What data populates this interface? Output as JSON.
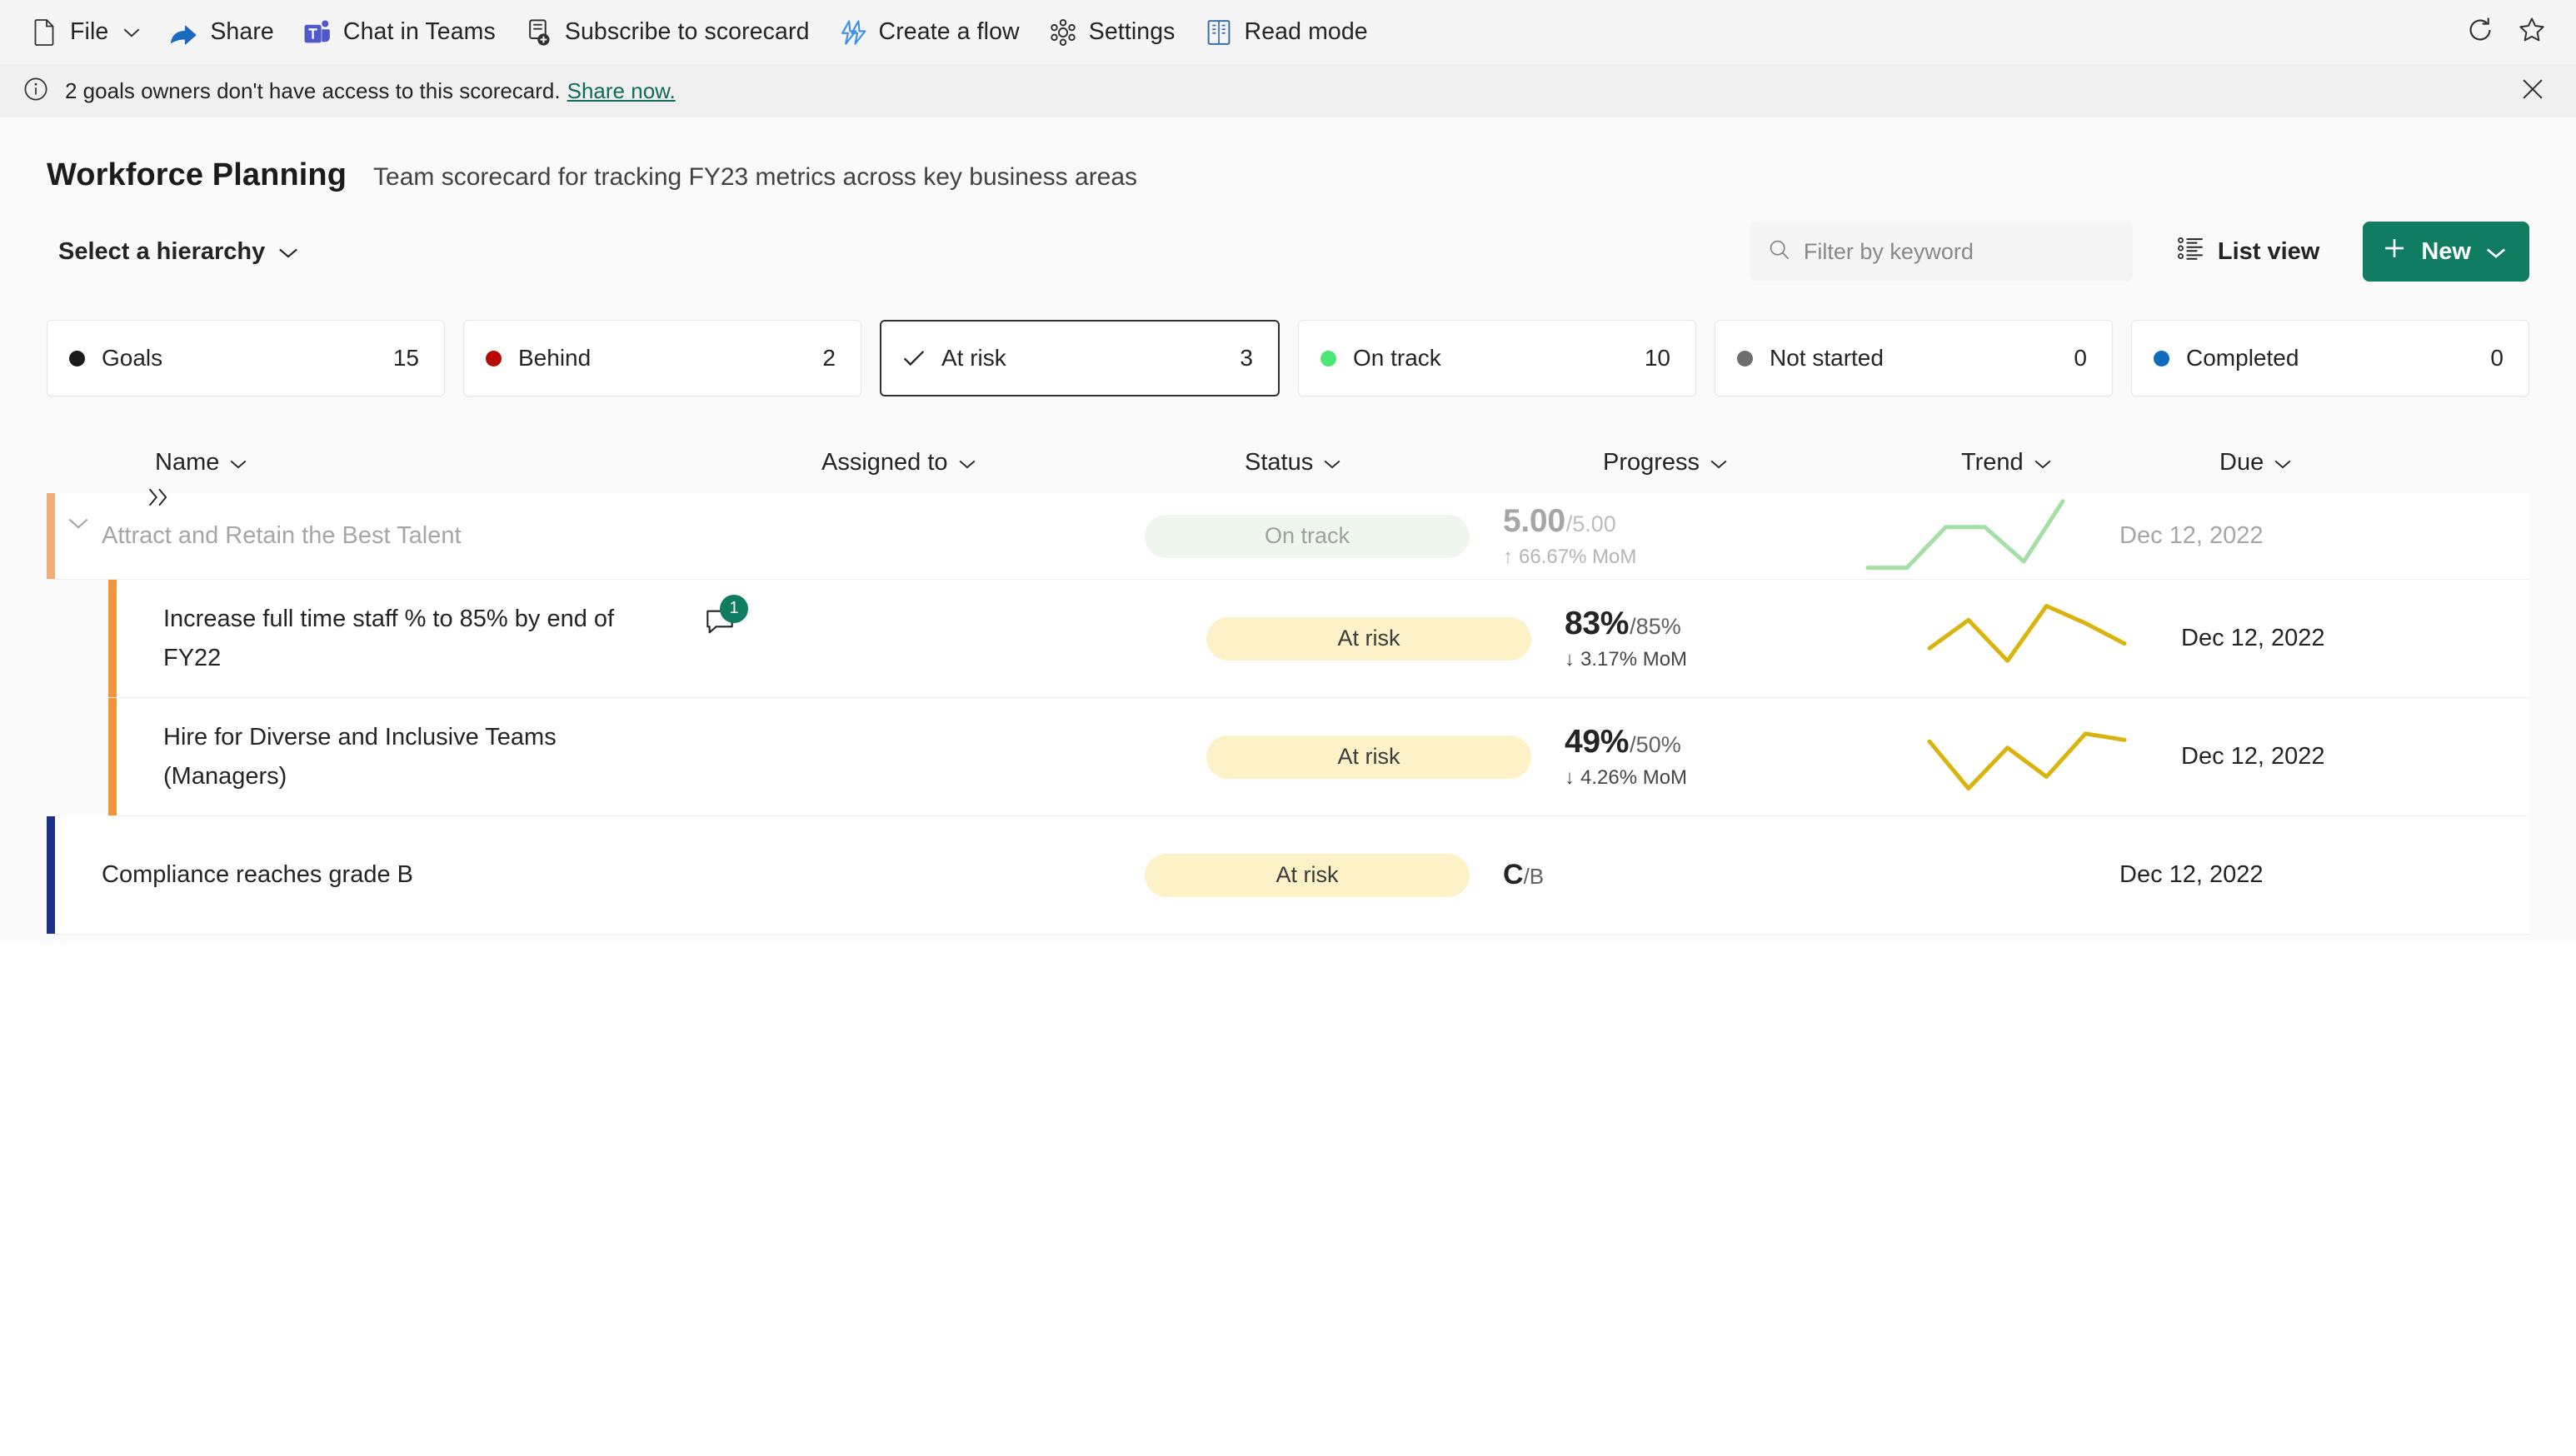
{
  "commandbar": {
    "items": [
      {
        "label": "File",
        "icon": "file-icon",
        "has_chevron": true
      },
      {
        "label": "Share",
        "icon": "share-icon",
        "has_chevron": false
      },
      {
        "label": "Chat in Teams",
        "icon": "teams-icon",
        "has_chevron": false
      },
      {
        "label": "Subscribe to scorecard",
        "icon": "subscribe-icon",
        "has_chevron": false
      },
      {
        "label": "Create a flow",
        "icon": "power-automate-icon",
        "has_chevron": false
      },
      {
        "label": "Settings",
        "icon": "gear-icon",
        "has_chevron": false
      },
      {
        "label": "Read mode",
        "icon": "read-mode-icon",
        "has_chevron": false
      }
    ],
    "right_icons": [
      {
        "name": "refresh-icon"
      },
      {
        "name": "favorite-star-icon"
      }
    ]
  },
  "messagebar": {
    "icon": "info-icon",
    "text": "2 goals owners don't have access to this scorecard.",
    "link": "Share now.",
    "close_icon": "close-icon"
  },
  "header": {
    "title": "Workforce Planning",
    "subtitle": "Team scorecard for tracking FY23 metrics across key business areas",
    "hierarchy_label": "Select a hierarchy"
  },
  "toolbar": {
    "search_placeholder": "Filter by keyword",
    "search_value": "",
    "list_view_label": "List view",
    "new_label": "New"
  },
  "pills": [
    {
      "label": "Goals",
      "count": "15",
      "color": "#1b1b1b",
      "selected": false,
      "marker": "dot"
    },
    {
      "label": "Behind",
      "count": "2",
      "color": "#b80b05",
      "selected": false,
      "marker": "dot"
    },
    {
      "label": "At risk",
      "count": "3",
      "color": "#242424",
      "selected": true,
      "marker": "check"
    },
    {
      "label": "On track",
      "count": "10",
      "color": "#4ce675",
      "selected": false,
      "marker": "dot"
    },
    {
      "label": "Not started",
      "count": "0",
      "color": "#6e6e6e",
      "selected": false,
      "marker": "dot"
    },
    {
      "label": "Completed",
      "count": "0",
      "color": "#0f6cbd",
      "selected": false,
      "marker": "dot"
    }
  ],
  "columns": [
    {
      "label": "Name"
    },
    {
      "label": "Assigned to"
    },
    {
      "label": "Status"
    },
    {
      "label": "Progress"
    },
    {
      "label": "Trend"
    },
    {
      "label": "Due"
    }
  ],
  "rows": [
    {
      "name": "Attract and Retain the Best Talent",
      "dimmed": true,
      "level": "parent",
      "expanded": true,
      "accent": "#f3ab78",
      "assigned_to": "",
      "status": "On track",
      "status_style": "ontrack",
      "progress_current": "5.00",
      "progress_target": "/5.00",
      "mom_direction": "up",
      "mom_text": "66.67% MoM",
      "trend_color": "#a5dfa5",
      "due": "Dec 12, 2022",
      "comments": 0
    },
    {
      "name": "Increase full time staff % to 85% by end of FY22",
      "dimmed": false,
      "level": "child",
      "accent": "#f2943c",
      "assigned_to": "",
      "status": "At risk",
      "status_style": "atrisk",
      "progress_current": "83%",
      "progress_target": "/85%",
      "mom_direction": "down",
      "mom_text": "3.17% MoM",
      "trend_color": "#d9b40e",
      "due": "Dec 12, 2022",
      "comments": 1
    },
    {
      "name": "Hire for Diverse and Inclusive Teams (Managers)",
      "dimmed": false,
      "level": "child",
      "accent": "#f2943c",
      "assigned_to": "",
      "status": "At risk",
      "status_style": "atrisk",
      "progress_current": "49%",
      "progress_target": "/50%",
      "mom_direction": "down",
      "mom_text": "4.26% MoM",
      "trend_color": "#d9b40e",
      "due": "Dec 12, 2022",
      "comments": 0
    },
    {
      "name": "Compliance reaches grade B",
      "dimmed": false,
      "level": "top",
      "accent": "#1b2f8c",
      "assigned_to": "",
      "status": "At risk",
      "status_style": "atrisk",
      "progress_current": "C",
      "progress_target": "/B",
      "mom_direction": "none",
      "mom_text": "",
      "trend_color": "",
      "due": "Dec 12, 2022",
      "comments": 0
    }
  ],
  "chart_data": [
    {
      "type": "line",
      "title": "Attract and Retain the Best Talent trend",
      "x": [
        0,
        1,
        2,
        3,
        4,
        5
      ],
      "values": [
        0.1,
        0.1,
        0.62,
        0.62,
        0.18,
        0.95
      ],
      "color": "#a5dfa5"
    },
    {
      "type": "line",
      "title": "Increase full time staff % to 85% by end of FY22 trend",
      "x": [
        0,
        1,
        2,
        3,
        4,
        5
      ],
      "values": [
        0.38,
        0.74,
        0.22,
        0.92,
        0.7,
        0.44
      ],
      "color": "#d9b40e"
    },
    {
      "type": "line",
      "title": "Hire for Diverse and Inclusive Teams (Managers) trend",
      "x": [
        0,
        1,
        2,
        3,
        4,
        5
      ],
      "values": [
        0.7,
        0.1,
        0.62,
        0.25,
        0.8,
        0.72
      ],
      "color": "#d9b40e"
    }
  ]
}
